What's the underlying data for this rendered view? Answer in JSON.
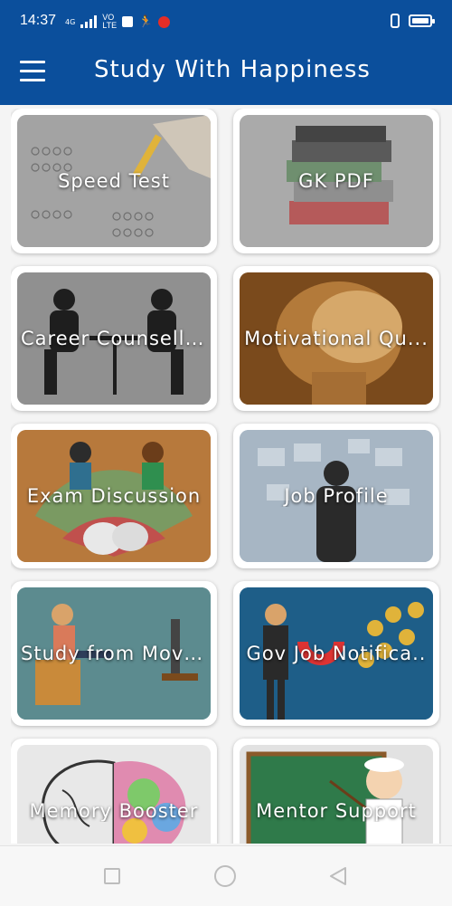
{
  "status": {
    "time": "14:37",
    "network": "4G",
    "volte_line1": "VO",
    "volte_line2": "LTE",
    "battery_level": 1.0
  },
  "appbar": {
    "title": "Study With Happiness",
    "menu_icon": "hamburger-menu-icon"
  },
  "cards": [
    {
      "label": "Speed Test",
      "theme": "answer-sheet"
    },
    {
      "label": "GK PDF",
      "theme": "books"
    },
    {
      "label": "Career Counselli...",
      "theme": "silhouettes-at-table"
    },
    {
      "label": "Motivational Qu...",
      "theme": "fist"
    },
    {
      "label": "Exam Discussion",
      "theme": "group-chat"
    },
    {
      "label": "Job Profile",
      "theme": "man-with-screens"
    },
    {
      "label": "Study from Movi...",
      "theme": "man-watching-tv"
    },
    {
      "label": "Gov Job Notifica..",
      "theme": "man-with-magnet"
    },
    {
      "label": "Memory Booster",
      "theme": "brain"
    },
    {
      "label": "Mentor Support",
      "theme": "teacher-at-blackboard"
    }
  ],
  "navbar": {
    "recents_icon": "square-icon",
    "home_icon": "circle-icon",
    "back_icon": "triangle-back-icon"
  },
  "colors": {
    "primary": "#0b4f9c",
    "card_bg": "#ffffff",
    "page_bg": "#f4f4f4"
  }
}
